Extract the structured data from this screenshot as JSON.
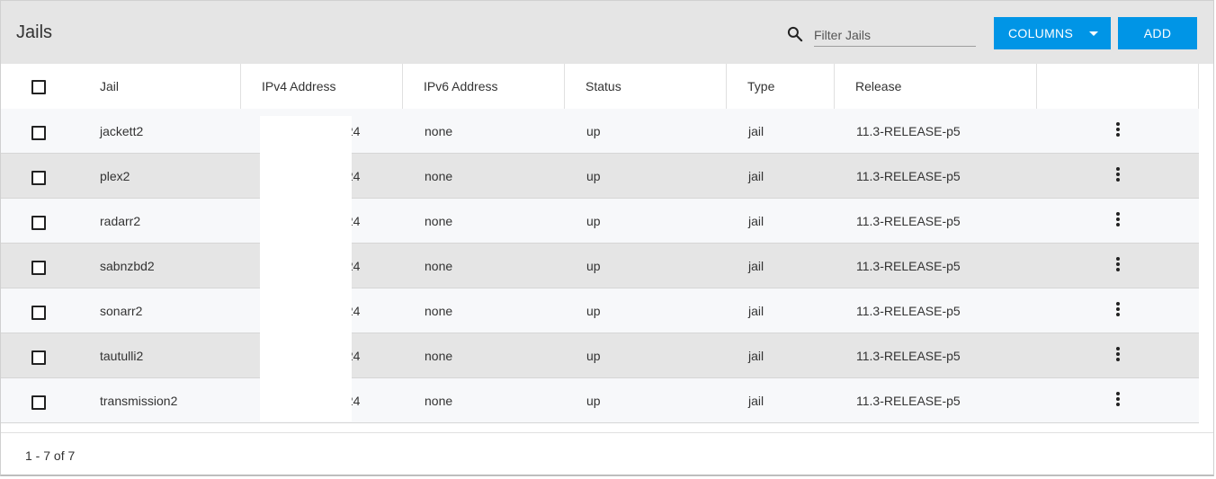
{
  "toolbar": {
    "title": "Jails",
    "search_placeholder": "Filter Jails",
    "columns_label": "COLUMNS",
    "add_label": "ADD"
  },
  "table": {
    "headers": {
      "jail": "Jail",
      "ipv4": "IPv4 Address",
      "ipv6": "IPv6 Address",
      "status": "Status",
      "type": "Type",
      "release": "Release"
    },
    "rows": [
      {
        "jail": "jackett2",
        "ipv4": "/24",
        "ipv6": "none",
        "status": "up",
        "type": "jail",
        "release": "11.3-RELEASE-p5"
      },
      {
        "jail": "plex2",
        "ipv4": "/24",
        "ipv6": "none",
        "status": "up",
        "type": "jail",
        "release": "11.3-RELEASE-p5"
      },
      {
        "jail": "radarr2",
        "ipv4": "/24",
        "ipv6": "none",
        "status": "up",
        "type": "jail",
        "release": "11.3-RELEASE-p5"
      },
      {
        "jail": "sabnzbd2",
        "ipv4": "/24",
        "ipv6": "none",
        "status": "up",
        "type": "jail",
        "release": "11.3-RELEASE-p5"
      },
      {
        "jail": "sonarr2",
        "ipv4": "/24",
        "ipv6": "none",
        "status": "up",
        "type": "jail",
        "release": "11.3-RELEASE-p5"
      },
      {
        "jail": "tautulli2",
        "ipv4": "/24",
        "ipv6": "none",
        "status": "up",
        "type": "jail",
        "release": "11.3-RELEASE-p5"
      },
      {
        "jail": "transmission2",
        "ipv4": "/24",
        "ipv6": "none",
        "status": "up",
        "type": "jail",
        "release": "11.3-RELEASE-p5"
      }
    ]
  },
  "footer": {
    "range": "1 - 7 of 7"
  },
  "icons": {
    "search": "search-icon",
    "columns_dropdown": "caret-down-icon",
    "row_actions": "more-vertical-icon"
  },
  "colors": {
    "toolbar_bg": "#e5e5e5",
    "primary_button": "#0095e6",
    "row_odd": "#f7f8fa",
    "row_even": "#e5e5e5"
  }
}
